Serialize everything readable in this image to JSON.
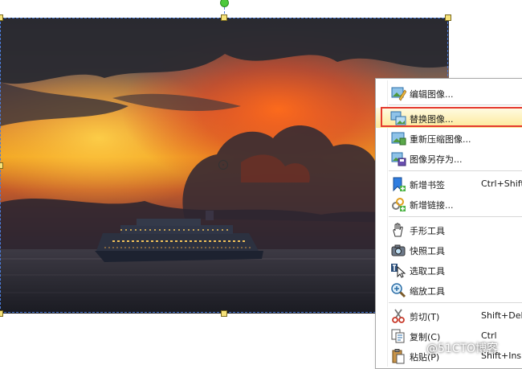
{
  "context_menu": {
    "items": [
      {
        "label": "编辑图像...",
        "shortcut": "",
        "icon": "edit-image-icon"
      },
      {
        "label": "替换图像...",
        "shortcut": "",
        "icon": "replace-image-icon"
      },
      {
        "label": "重新压缩图像...",
        "shortcut": "",
        "icon": "recompress-image-icon"
      },
      {
        "label": "图像另存为...",
        "shortcut": "",
        "icon": "save-image-as-icon"
      },
      {
        "label": "新增书签",
        "shortcut": "Ctrl+Shift",
        "icon": "add-bookmark-icon"
      },
      {
        "label": "新增链接...",
        "shortcut": "",
        "icon": "add-link-icon"
      },
      {
        "label": "手形工具",
        "shortcut": "",
        "icon": "hand-tool-icon"
      },
      {
        "label": "快照工具",
        "shortcut": "",
        "icon": "snapshot-tool-icon"
      },
      {
        "label": "选取工具",
        "shortcut": "",
        "icon": "select-tool-icon"
      },
      {
        "label": "缩放工具",
        "shortcut": "",
        "icon": "zoom-tool-icon"
      },
      {
        "label": "剪切(T)",
        "shortcut": "Shift+Dele",
        "icon": "cut-icon"
      },
      {
        "label": "复制(C)",
        "shortcut": "Ctrl",
        "icon": "copy-icon"
      },
      {
        "label": "粘贴(P)",
        "shortcut": "Shift+Ins",
        "icon": "paste-icon"
      }
    ],
    "highlighted_item": "替换图像...",
    "highlight_color": "#e53a2f"
  },
  "watermark": "@51CTO博客"
}
